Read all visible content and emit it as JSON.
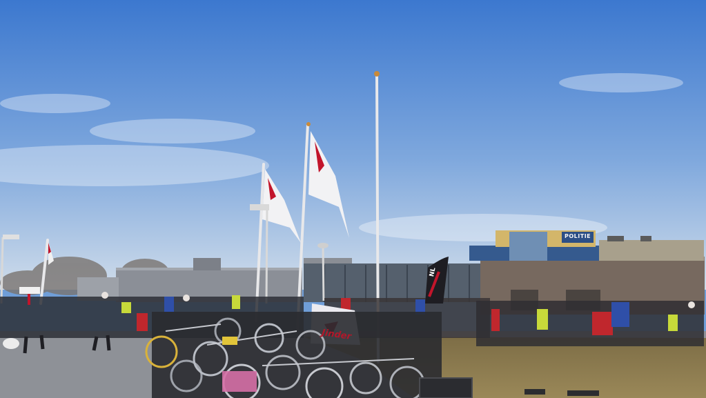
{
  "scene": {
    "sky_top": "#3f7cd0",
    "sky_bottom": "#c7d9ee",
    "grass": "#857549",
    "pavement": "#8f9298",
    "building_grey": "#8c9098",
    "building_brick": "#7a6e68",
    "flag_red": "#c2152b"
  },
  "signage": {
    "police_sign": "POLITIE",
    "banner_text": "Jinder",
    "feather_flag_text": "NL"
  }
}
